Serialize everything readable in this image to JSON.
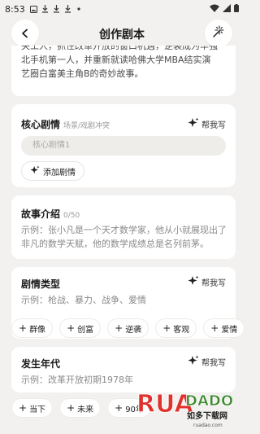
{
  "status_bar": {
    "time": "8:53"
  },
  "header": {
    "title": "创作剧本"
  },
  "synopsis": {
    "lines": [
      "关工人，抓住改革开放的窗口机遇，逆袭成为华强",
      "北手机第一人，并重新就读哈佛大学MBA结实演",
      "艺圈白富美主角B的奇妙故事。"
    ]
  },
  "core_plot": {
    "title": "核心剧情",
    "subtitle": "场景/戏剧冲突",
    "help_label": "帮我写",
    "input_placeholder": "核心剧情1",
    "add_label": "添加剧情"
  },
  "story_intro": {
    "title": "故事介绍",
    "count": "0/50",
    "example": "示例：张小凡是一个天才数学家，他从小就展现出了非凡的数学天赋，他的数学成绩总是名列前茅。"
  },
  "genre": {
    "title": "剧情类型",
    "help_label": "帮我写",
    "example": "示例：枪战、暴力、战争、爱情",
    "chips": [
      "群像",
      "创富",
      "逆袭",
      "客观",
      "爱情"
    ]
  },
  "era": {
    "title": "发生年代",
    "help_label": "帮我写",
    "example": "示例：改革开放初期1978年",
    "chips": [
      "当下",
      "未来",
      "90年"
    ]
  },
  "watermark": {
    "text": "RUANDADO",
    "sub": "如多下载网",
    "url": "ruadao.com"
  },
  "colors": {
    "background": "#f2f1ef",
    "card": "#ffffff",
    "input": "#efedea",
    "watermark_red": "#e0322d",
    "watermark_green": "#3d8a2f"
  }
}
